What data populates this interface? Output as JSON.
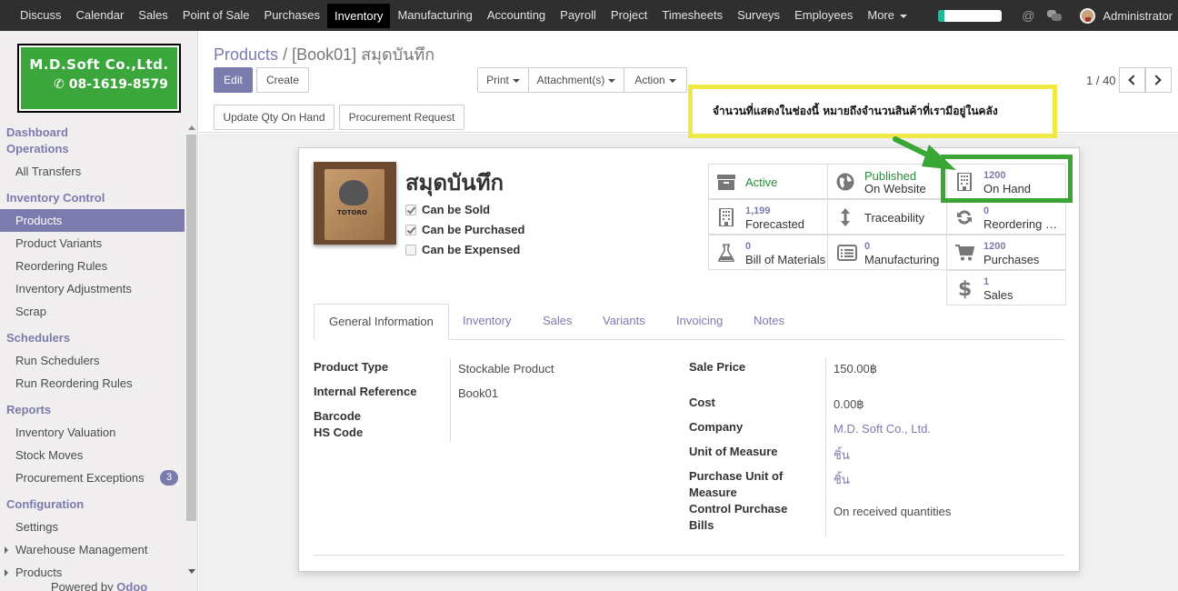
{
  "topbar": {
    "menu": [
      "Discuss",
      "Calendar",
      "Sales",
      "Point of Sale",
      "Purchases",
      "Inventory",
      "Manufacturing",
      "Accounting",
      "Payroll",
      "Project",
      "Timesheets",
      "Surveys",
      "Employees",
      "More"
    ],
    "active": "Inventory",
    "progress": 0.1,
    "user": "Administrator",
    "at_symbol": "@"
  },
  "logo": {
    "company": "M.D.Soft Co.,Ltd.",
    "phone": "✆ 08-1619-8579"
  },
  "sidebar": {
    "sections": [
      {
        "title": "Dashboard\nOperations",
        "items": [
          {
            "label": "All Transfers"
          }
        ]
      },
      {
        "title": "Inventory Control",
        "items": [
          {
            "label": "Products",
            "active": true
          },
          {
            "label": "Product Variants"
          },
          {
            "label": "Reordering Rules"
          },
          {
            "label": "Inventory Adjustments"
          },
          {
            "label": "Scrap"
          }
        ]
      },
      {
        "title": "Schedulers",
        "items": [
          {
            "label": "Run Schedulers"
          },
          {
            "label": "Run Reordering Rules"
          }
        ]
      },
      {
        "title": "Reports",
        "items": [
          {
            "label": "Inventory Valuation"
          },
          {
            "label": "Stock Moves"
          },
          {
            "label": "Procurement Exceptions",
            "badge": "3"
          }
        ]
      },
      {
        "title": "Configuration",
        "items": [
          {
            "label": "Settings"
          },
          {
            "label": "Warehouse Management",
            "arrow": true
          },
          {
            "label": "Products",
            "arrow": true
          }
        ]
      }
    ],
    "powered_prefix": "Powered by",
    "powered_brand": "Odoo"
  },
  "breadcrumb": {
    "parent": "Products",
    "sep": "/",
    "current": "[Book01] สมุดบันทึก"
  },
  "buttons": {
    "edit": "Edit",
    "create": "Create",
    "print": "Print",
    "attachments": "Attachment(s)",
    "action": "Action",
    "update_qty": "Update Qty On Hand",
    "procurement": "Procurement Request"
  },
  "pager": "1 / 40",
  "product": {
    "name": "สมุดบันทึก",
    "image_label": "TOTORO",
    "can_be_sold": {
      "label": "Can be Sold",
      "checked": true
    },
    "can_be_purchased": {
      "label": "Can be Purchased",
      "checked": true
    },
    "can_be_expensed": {
      "label": "Can be Expensed",
      "checked": false
    }
  },
  "smart_buttons": {
    "active": "Active",
    "published": {
      "l1": "Published",
      "l2": "On Website"
    },
    "on_hand": {
      "value": "1200",
      "label": "On Hand"
    },
    "forecasted": {
      "value": "1,199",
      "label": "Forecasted"
    },
    "traceability": "Traceability",
    "reordering": {
      "value": "0",
      "label": "Reordering Rules"
    },
    "bom": {
      "value": "0",
      "label": "Bill of Materials"
    },
    "manufacturing": {
      "value": "0",
      "label": "Manufacturing"
    },
    "purchases": {
      "value": "1200",
      "label": "Purchases"
    },
    "sales": {
      "value": "1",
      "label": "Sales"
    }
  },
  "tabs": [
    "General Information",
    "Inventory",
    "Sales",
    "Variants",
    "Invoicing",
    "Notes"
  ],
  "fields_left": {
    "product_type": {
      "label": "Product Type",
      "value": "Stockable Product"
    },
    "internal_ref": {
      "label": "Internal Reference",
      "value": "Book01"
    },
    "barcode": {
      "label": "Barcode"
    },
    "hs_code": {
      "label": "HS Code"
    }
  },
  "fields_right": {
    "sale_price": {
      "label": "Sale Price",
      "value": "150.00฿"
    },
    "cost": {
      "label": "Cost",
      "value": "0.00฿"
    },
    "company": {
      "label": "Company",
      "value": "M.D. Soft Co., Ltd."
    },
    "uom": {
      "label": "Unit of Measure",
      "value": "ชิ้น"
    },
    "purchase_uom": {
      "label1": "Purchase Unit of",
      "label2": "Measure",
      "value": "ชิ้น"
    },
    "control_bills": {
      "label1": "Control Purchase",
      "label2": "Bills",
      "value": "On received quantities"
    }
  },
  "annotation": "จำนวนที่แสดงในช่องนี้ หมายถึงจำนวนสินค้าที่เรามีอยู่ในคลัง",
  "colors": {
    "brand": "#7c7bad",
    "topbar": "#2f2f2f",
    "annotation_border": "#f0e845",
    "highlight": "#3aa636",
    "active_green": "#2a8a3c"
  }
}
